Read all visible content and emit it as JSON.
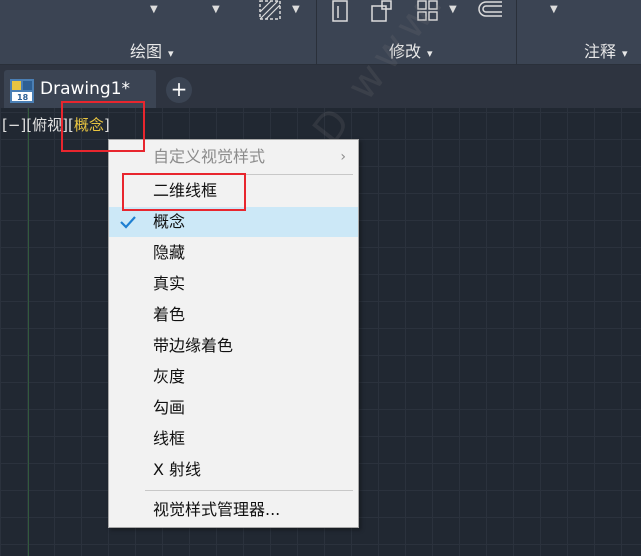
{
  "ribbon": {
    "panels": [
      {
        "label": "绘图"
      },
      {
        "label": "修改"
      },
      {
        "label": "注释"
      }
    ],
    "caret": "▾"
  },
  "tabs": {
    "document_tab": "Drawing1*",
    "add_tab": "+"
  },
  "viewport_controls": {
    "minus": "[−]",
    "view_open": "[",
    "view": "俯视",
    "view_close": "]",
    "style_open": "[",
    "visual_style": "概念",
    "style_close": "]"
  },
  "context_menu": {
    "header": "自定义视觉样式",
    "header_arrow": "›",
    "items": [
      {
        "label": "二维线框",
        "checked": false
      },
      {
        "label": "概念",
        "checked": true
      },
      {
        "label": "隐藏",
        "checked": false
      },
      {
        "label": "真实",
        "checked": false
      },
      {
        "label": "着色",
        "checked": false
      },
      {
        "label": "带边缘着色",
        "checked": false
      },
      {
        "label": "灰度",
        "checked": false
      },
      {
        "label": "勾画",
        "checked": false
      },
      {
        "label": "线框",
        "checked": false
      },
      {
        "label": "X 射线",
        "checked": false
      }
    ],
    "manager": "视觉样式管理器..."
  },
  "watermark": "周站长CAD www.zzzcad.com",
  "colors": {
    "accent_red": "#e8262e",
    "selected_style": "#e8c440",
    "check": "#1e7fd1",
    "hover_bg": "#cce8f7"
  }
}
